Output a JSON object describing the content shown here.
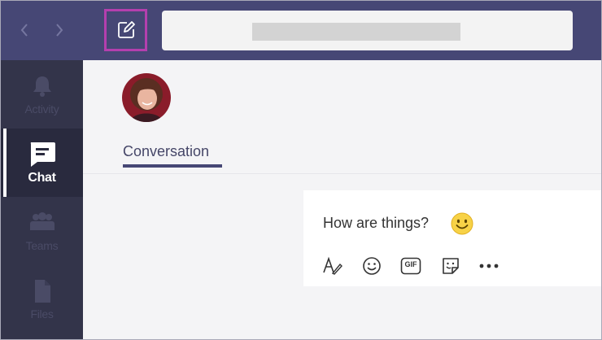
{
  "rail": {
    "items": [
      {
        "label": "Activity",
        "icon": "bell-icon"
      },
      {
        "label": "Chat",
        "icon": "chat-icon"
      },
      {
        "label": "Teams",
        "icon": "teams-icon"
      },
      {
        "label": "Files",
        "icon": "file-icon"
      }
    ],
    "active": "Chat"
  },
  "topbar": {
    "nav": [
      "back-arrow-icon",
      "forward-arrow-icon"
    ],
    "compose_icon": "compose-icon"
  },
  "conversation": {
    "tab_label": "Conversation"
  },
  "message": {
    "text": "How are things?",
    "emoji": "smiley-emoji"
  },
  "toolbar": {
    "icons": [
      "format-icon",
      "emoji-icon",
      "gif-icon",
      "sticker-icon",
      "more-icon"
    ],
    "gif_label": "GIF"
  },
  "colors": {
    "topbar": "#464775",
    "rail": "#33344a",
    "highlight": "#b43fae",
    "accent": "#464775"
  }
}
